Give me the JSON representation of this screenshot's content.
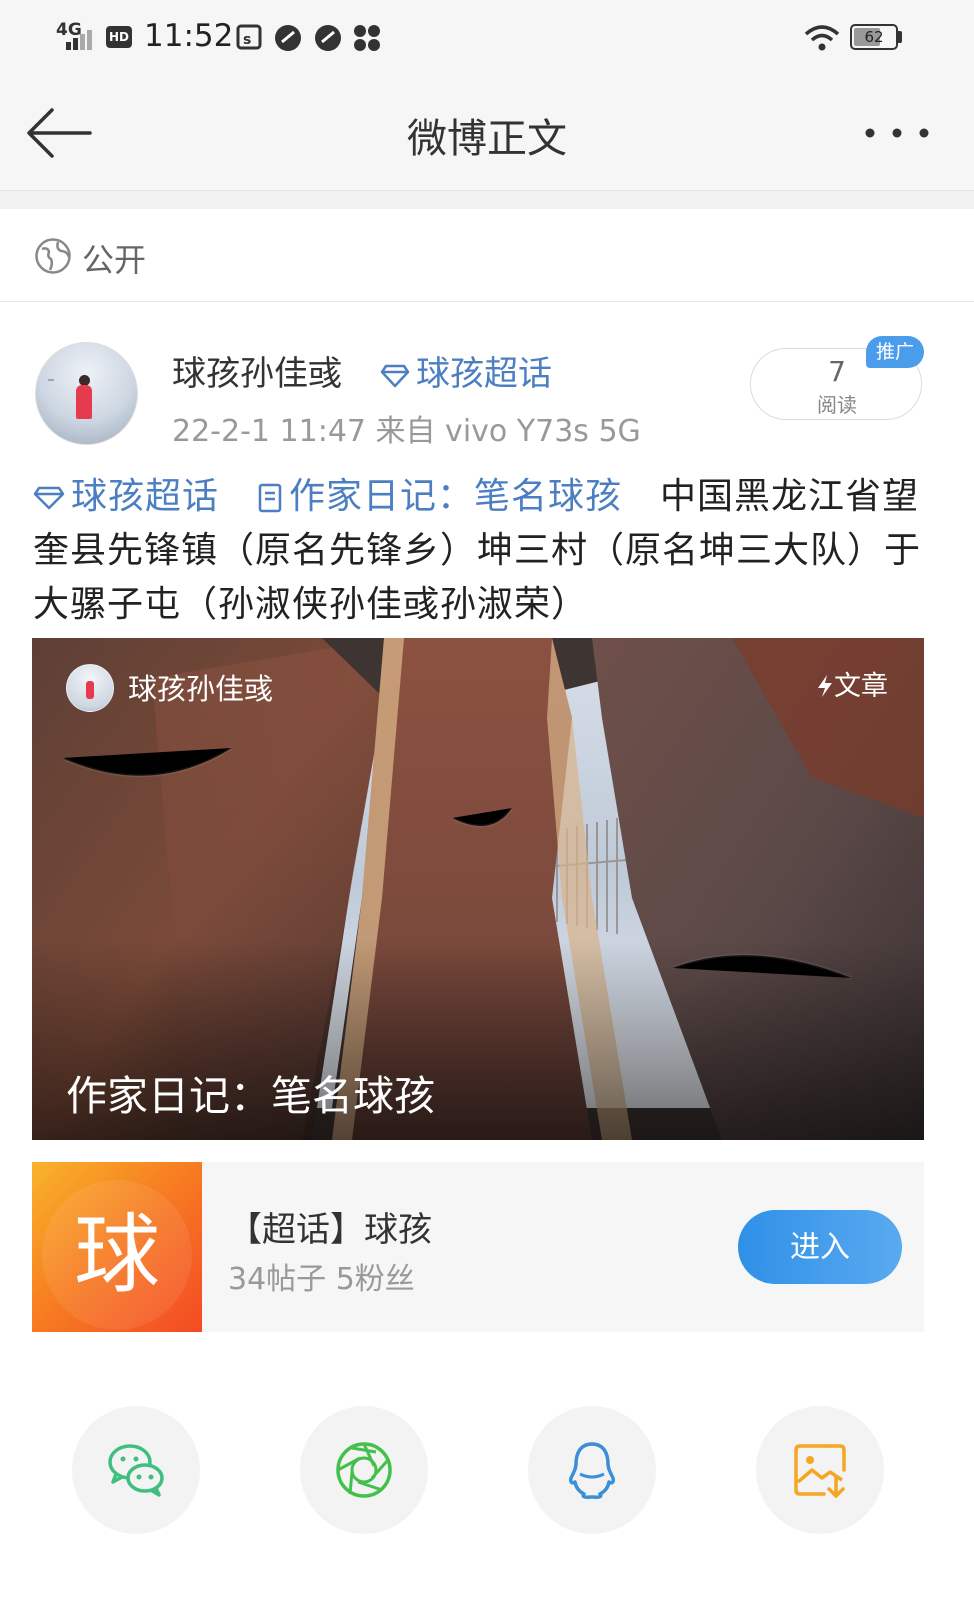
{
  "status_bar": {
    "network": "4G",
    "hd": "HD",
    "time": "11:52",
    "battery": "62"
  },
  "nav": {
    "title": "微博正文",
    "more_icon": "more-dots-icon"
  },
  "visibility": {
    "icon": "globe-icon",
    "label": "公开"
  },
  "post": {
    "author": "球孩孙佳彧",
    "supertopic_link": "球孩超话",
    "meta": "22-2-1  11:47  来自  vivo  Y73s  5G",
    "read_count": "7",
    "read_label": "阅读",
    "promo_tag": "推广",
    "tags": [
      "球孩超话",
      "作家日记：笔名球孩"
    ],
    "text": "中国黑龙江省望奎县先锋镇（原名先锋乡）坤三村（原名坤三大队）于大骡子屯（孙淑侠孙佳彧孙淑荣）"
  },
  "article_card": {
    "author": "球孩孙佳彧",
    "type": "文章",
    "title": "作家日记：笔名球孩"
  },
  "supertopic": {
    "thumb_char": "球",
    "title": "【超话】球孩",
    "stats": "34帖子  5粉丝",
    "enter_label": "进入"
  },
  "share": {
    "items": [
      {
        "icon": "wechat-icon",
        "color": "#3fbf7f"
      },
      {
        "icon": "moments-icon",
        "color": "#43c04b"
      },
      {
        "icon": "qq-icon",
        "color": "#3a8fd9"
      },
      {
        "icon": "save-image-icon",
        "color": "#f5a623"
      }
    ]
  }
}
